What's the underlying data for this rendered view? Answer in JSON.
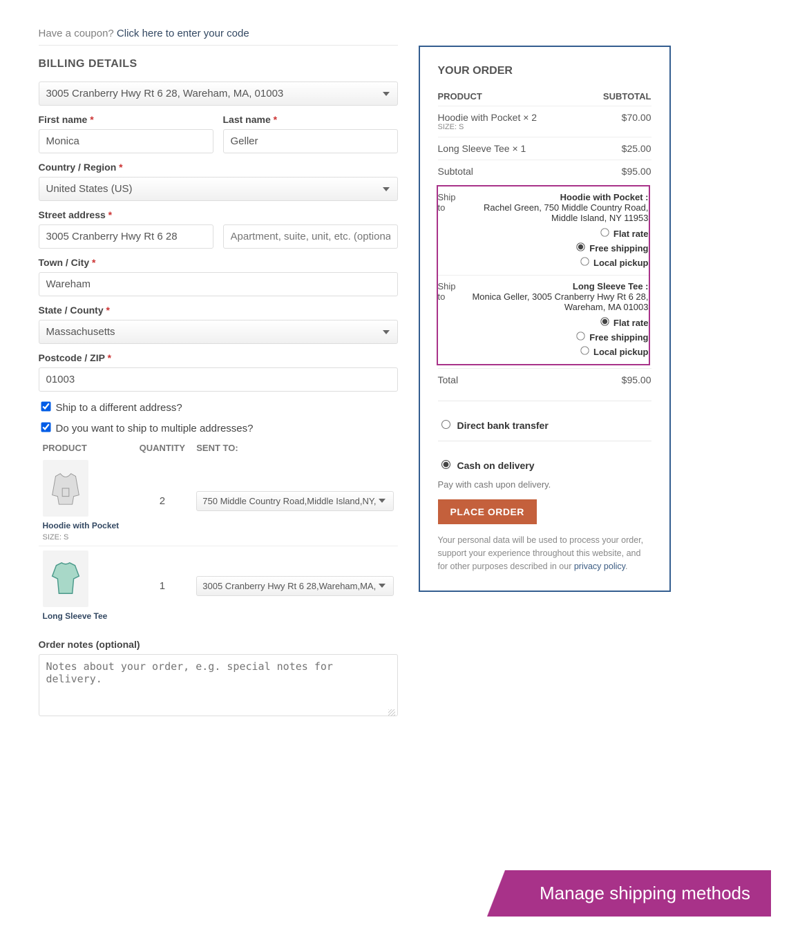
{
  "coupon": {
    "prompt": "Have a coupon? ",
    "link": "Click here to enter your code"
  },
  "billing": {
    "heading": "BILLING DETAILS",
    "saved_address": "3005 Cranberry Hwy Rt 6 28, Wareham, MA, 01003",
    "labels": {
      "first": "First name",
      "last": "Last name",
      "country": "Country / Region",
      "street": "Street address",
      "city": "Town / City",
      "state": "State / County",
      "zip": "Postcode / ZIP"
    },
    "first": "Monica",
    "last": "Geller",
    "country": "United States (US)",
    "street": "3005 Cranberry Hwy Rt 6 28",
    "apt_placeholder": "Apartment, suite, unit, etc. (optional)",
    "city": "Wareham",
    "state": "Massachusetts",
    "zip": "01003"
  },
  "ship_diff": "Ship to a different address?",
  "ship_multi": "Do you want to ship to multiple addresses?",
  "multi_cols": {
    "product": "PRODUCT",
    "qty": "QUANTITY",
    "sent": "SENT TO:"
  },
  "multi_rows": [
    {
      "name": "Hoodie with Pocket",
      "size": "SIZE:   S",
      "qty": "2",
      "dest": "750 Middle Country Road,Middle Island,NY,"
    },
    {
      "name": "Long Sleeve Tee",
      "size": "",
      "qty": "1",
      "dest": "3005 Cranberry Hwy Rt 6 28,Wareham,MA,"
    }
  ],
  "notes": {
    "label": "Order notes (optional)",
    "placeholder": "Notes about your order, e.g. special notes for delivery."
  },
  "order": {
    "heading": "YOUR ORDER",
    "product": "PRODUCT",
    "subtotal": "SUBTOTAL",
    "lines": [
      {
        "name": "Hoodie with Pocket  × 2",
        "size": "SIZE:   S",
        "price": "$70.00"
      },
      {
        "name": "Long Sleeve Tee × 1",
        "size": "",
        "price": "$25.00"
      }
    ],
    "subtotal_label": "Subtotal",
    "subtotal_val": "$95.00",
    "shipto": "Ship to",
    "ship": [
      {
        "title": "Hoodie with Pocket :",
        "addr": "Rachel Green, 750 Middle Country Road, Middle Island, NY 11953",
        "selected": 1
      },
      {
        "title": "Long Sleeve Tee :",
        "addr": "Monica Geller, 3005 Cranberry Hwy Rt 6 28, Wareham, MA 01003",
        "selected": 0
      }
    ],
    "opts": [
      "Flat rate",
      "Free shipping",
      "Local pickup"
    ],
    "total_label": "Total",
    "total_val": "$95.00",
    "pay": [
      "Direct bank transfer",
      "Cash on delivery"
    ],
    "pay_desc": "Pay with cash upon delivery.",
    "button": "PLACE ORDER",
    "privacy": "Your personal data will be used to process your order, support your experience throughout this website, and for other purposes described in our ",
    "privacy_link": "privacy policy"
  },
  "banner": "Manage shipping methods"
}
